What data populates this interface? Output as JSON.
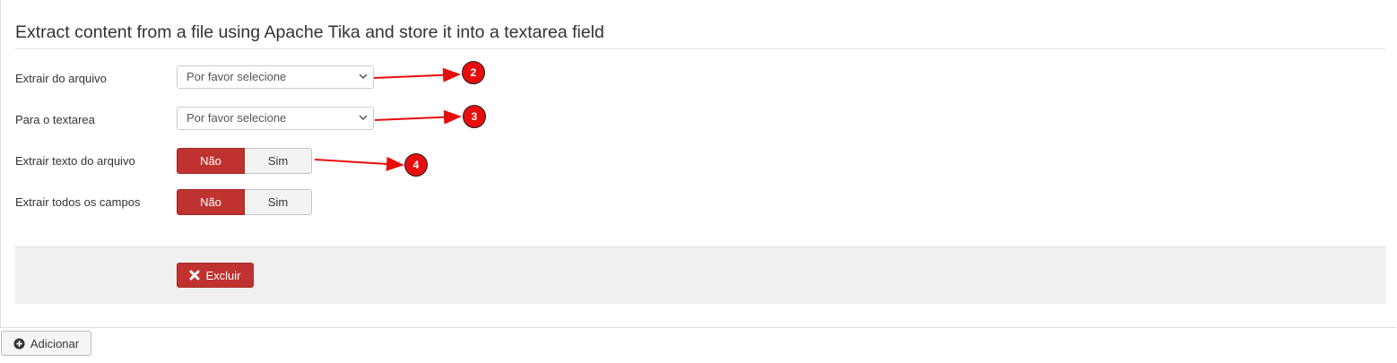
{
  "form": {
    "legend": "Extract content from a file using Apache Tika and store it into a textarea field",
    "fields": [
      {
        "label": "Extrair do arquivo",
        "value": "Por favor selecione"
      },
      {
        "label": "Para o textarea",
        "value": "Por favor selecione"
      }
    ],
    "toggles": [
      {
        "label": "Extrair texto do arquivo",
        "no": "Não",
        "yes": "Sim",
        "selected": "Não"
      },
      {
        "label": "Extrair todos os campos",
        "no": "Não",
        "yes": "Sim",
        "selected": "Não"
      }
    ],
    "delete_label": "Excluir"
  },
  "add_label": "Adicionar",
  "annotations": [
    "2",
    "3",
    "4"
  ],
  "colors": {
    "danger": "#c0322f",
    "annotation": "#e80d0d"
  },
  "icons": [
    "chevron-down-icon",
    "close-icon",
    "plus-circle-icon"
  ]
}
